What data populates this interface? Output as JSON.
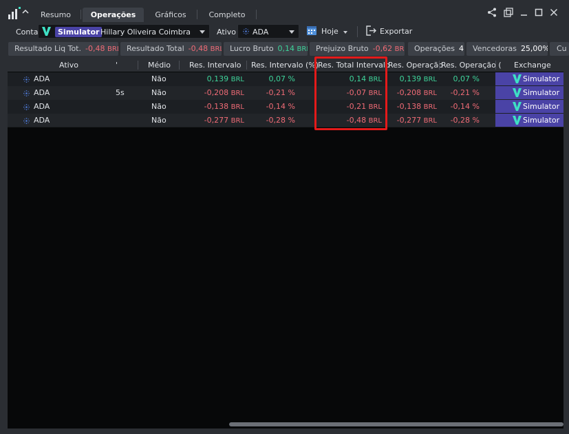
{
  "tabs": [
    {
      "label": "Resumo",
      "active": false
    },
    {
      "label": "Operações",
      "active": true
    },
    {
      "label": "Gráficos",
      "active": false
    },
    {
      "label": "Completo",
      "active": false
    }
  ],
  "window_controls": [
    "share-icon",
    "popout-icon",
    "minimize-icon",
    "maximize-icon",
    "close-icon"
  ],
  "toolbar": {
    "conta_label": "Conta",
    "account_badge": "Simulator",
    "account_name": "Hillary Oliveira Coimbra",
    "ativo_label": "Ativo",
    "ativo_value": "ADA",
    "period_value": "Hoje",
    "export_label": "Exportar"
  },
  "stats": [
    {
      "label": "Resultado Liq Tot.",
      "value": "-0,48",
      "unit": "BRL",
      "tone": "neg"
    },
    {
      "label": "Resultado Total",
      "value": "-0,48",
      "unit": "BRL",
      "tone": "neg"
    },
    {
      "label": "Lucro Bruto",
      "value": "0,14",
      "unit": "BRL",
      "tone": "pos"
    },
    {
      "label": "Prejuizo Bruto",
      "value": "-0,62",
      "unit": "BRL",
      "tone": "neg"
    },
    {
      "label": "Operações",
      "value": "4",
      "unit": "",
      "tone": "plain"
    },
    {
      "label": "Vencedoras",
      "value": "25,00%",
      "unit": "",
      "tone": "plain"
    },
    {
      "label": "Cu",
      "value": "",
      "unit": "",
      "tone": "plain"
    }
  ],
  "columns": {
    "ativo": "Ativo",
    "tick": "'",
    "medio": "Médio",
    "res_intervalo": "Res. Intervalo",
    "res_intervalo_pct": "Res. Intervalo (%)",
    "res_total_intervalo": "Res. Total Intervalo",
    "res_operacao": "Res. Operação",
    "res_operacao_pct": "Res. Operação (",
    "exchange": "Exchange"
  },
  "rows": [
    {
      "ativo": "ADA",
      "extra": "",
      "medio": "Não",
      "res_intervalo": "0,139",
      "res_intervalo_pct": "0,07 %",
      "res_total_intervalo": "0,14",
      "res_operacao": "0,139",
      "res_operacao_pct": "0,07 %",
      "unit": "BRL",
      "tone": "pos",
      "exchange": "Simulator"
    },
    {
      "ativo": "ADA",
      "extra": "5s",
      "medio": "Não",
      "res_intervalo": "-0,208",
      "res_intervalo_pct": "-0,21 %",
      "res_total_intervalo": "-0,07",
      "res_operacao": "-0,208",
      "res_operacao_pct": "-0,21 %",
      "unit": "BRL",
      "tone": "neg",
      "exchange": "Simulator"
    },
    {
      "ativo": "ADA",
      "extra": "",
      "medio": "Não",
      "res_intervalo": "-0,138",
      "res_intervalo_pct": "-0,14 %",
      "res_total_intervalo": "-0,21",
      "res_operacao": "-0,138",
      "res_operacao_pct": "-0,14 %",
      "unit": "BRL",
      "tone": "neg",
      "exchange": "Simulator"
    },
    {
      "ativo": "ADA",
      "extra": "",
      "medio": "Não",
      "res_intervalo": "-0,277",
      "res_intervalo_pct": "-0,28 %",
      "res_total_intervalo": "-0,48",
      "res_operacao": "-0,277",
      "res_operacao_pct": "-0,28 %",
      "unit": "BRL",
      "tone": "neg",
      "exchange": "Simulator"
    }
  ],
  "colors": {
    "positive": "#3ed49a",
    "negative": "#f06b76",
    "accent": "#4a43a6",
    "highlight": "#e41a1a",
    "brand_teal": "#3ee0c4"
  }
}
